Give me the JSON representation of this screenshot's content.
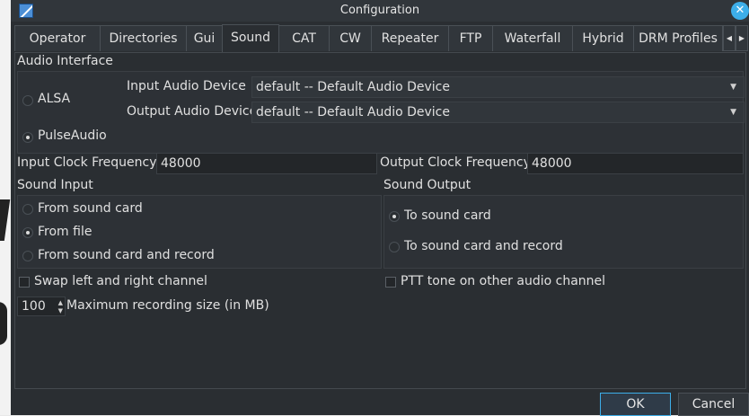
{
  "window": {
    "title": "Configuration"
  },
  "tabs": [
    "Operator",
    "Directories",
    "Gui",
    "Sound",
    "CAT",
    "CW",
    "Repeater",
    "FTP",
    "Waterfall",
    "Hybrid",
    "DRM Profiles"
  ],
  "active_tab": "Sound",
  "audio_interface": {
    "title": "Audio Interface",
    "alsa_label": "ALSA",
    "pulseaudio_label": "PulseAudio",
    "selected": "PulseAudio",
    "input_device_label": "Input Audio Device",
    "input_device_value": "default -- Default Audio Device",
    "output_device_label": "Output Audio Device",
    "output_device_value": "default -- Default Audio Device"
  },
  "clock": {
    "input_label": "Input  Clock Frequency",
    "input_value": "48000",
    "output_label": "Output Clock Frequency",
    "output_value": "48000"
  },
  "sound_input": {
    "title": "Sound Input",
    "options": [
      "From sound card",
      "From file",
      "From sound card and record"
    ],
    "selected": "From file"
  },
  "sound_output": {
    "title": "Sound Output",
    "options": [
      "To sound card",
      "To sound card and record"
    ],
    "selected": "To sound card"
  },
  "swap_channels": {
    "label": "Swap left and right channel",
    "checked": false
  },
  "ptt_tone": {
    "label": "PTT tone on other audio channel",
    "checked": false
  },
  "max_recording": {
    "value": "100",
    "label": "Maximum recording size (in MB)"
  },
  "buttons": {
    "ok": "OK",
    "cancel": "Cancel"
  },
  "colors": {
    "window_bg": "#2a2e32",
    "accent": "#3daee9"
  },
  "icons": {
    "app": "app-icon",
    "close": "close-icon"
  }
}
